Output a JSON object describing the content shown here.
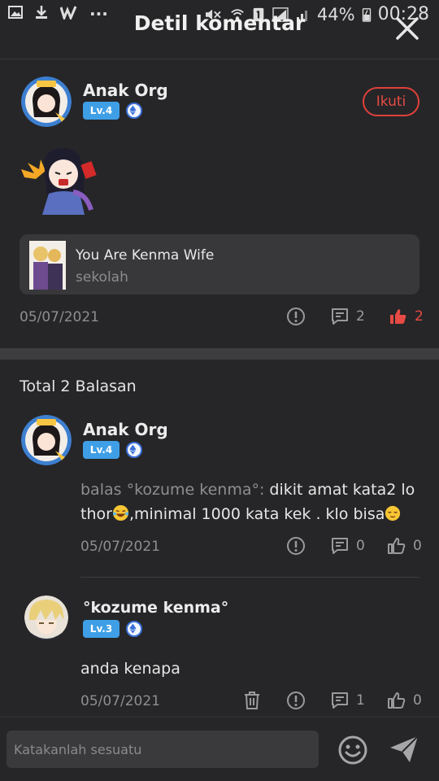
{
  "status_bar": {
    "left_icons": [
      "image-icon",
      "download-icon",
      "w-app-icon"
    ],
    "more": "...",
    "battery_percent": "44%",
    "time": "00:28"
  },
  "header": {
    "title": "Detil komentar"
  },
  "comment": {
    "user": "Anak Org",
    "level": "Lv.4",
    "follow_label": "Ikuti",
    "novel": {
      "title": "You Are Kenma Wife",
      "subtitle": "sekolah"
    },
    "date": "05/07/2021",
    "reply_count": "2",
    "like_count": "2"
  },
  "replies_header": "Total 2 Balasan",
  "replies": [
    {
      "user": "Anak Org",
      "level": "Lv.4",
      "prefix": "balas °kozume kenma°:",
      "text_line1": " dikit amat kata2 lo",
      "text_line2_a": "thor",
      "text_line2_b": ",minimal 1000 kata kek . klo bisa",
      "date": "05/07/2021",
      "reply_count": "0",
      "like_count": "0"
    },
    {
      "user": "°kozume kenma°",
      "level": "Lv.3",
      "text": "anda kenapa",
      "date": "05/07/2021",
      "reply_count": "1",
      "like_count": "0"
    }
  ],
  "composer": {
    "placeholder": "Katakanlah sesuatu"
  },
  "colors": {
    "accent_red": "#e84a44",
    "level_blue": "#3f9fe6",
    "bg": "#262628"
  }
}
